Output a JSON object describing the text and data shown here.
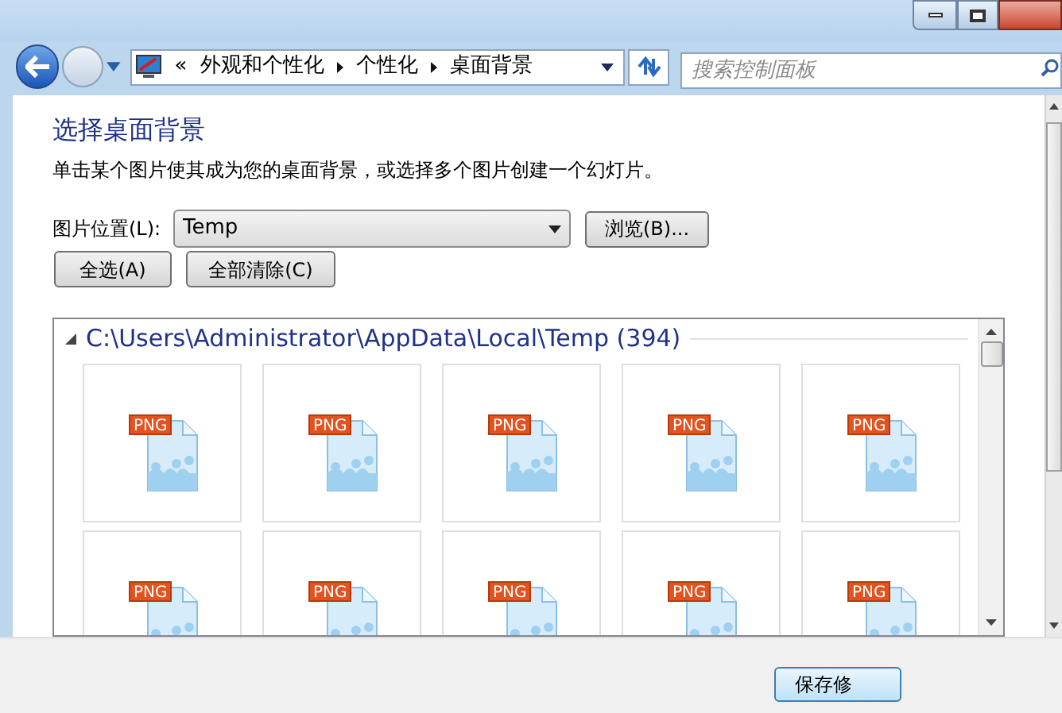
{
  "address_bar": {
    "overflow": "«",
    "crumbs": [
      "外观和个性化",
      "个性化",
      "桌面背景"
    ]
  },
  "search": {
    "placeholder": "搜索控制面板"
  },
  "heading": "选择桌面背景",
  "description": "单击某个图片使其成为您的桌面背景，或选择多个图片创建一个幻灯片。",
  "location": {
    "label": "图片位置(L):",
    "value": "Temp"
  },
  "buttons": [
    "浏览(B)...",
    "全选(A)",
    "全部清除(C)"
  ],
  "group": {
    "title": "C:\\Users\\Administrator\\AppData\\Local\\Temp (394)",
    "expanded": true
  },
  "tiles": [
    {
      "label": "PNG"
    },
    {
      "label": "PNG"
    },
    {
      "label": "PNG"
    },
    {
      "label": "PNG"
    },
    {
      "label": "PNG"
    },
    {
      "label": "PNG"
    },
    {
      "label": "PNG"
    },
    {
      "label": "PNG"
    },
    {
      "label": "PNG"
    },
    {
      "label": "PNG"
    }
  ],
  "footer_button": "保存修"
}
